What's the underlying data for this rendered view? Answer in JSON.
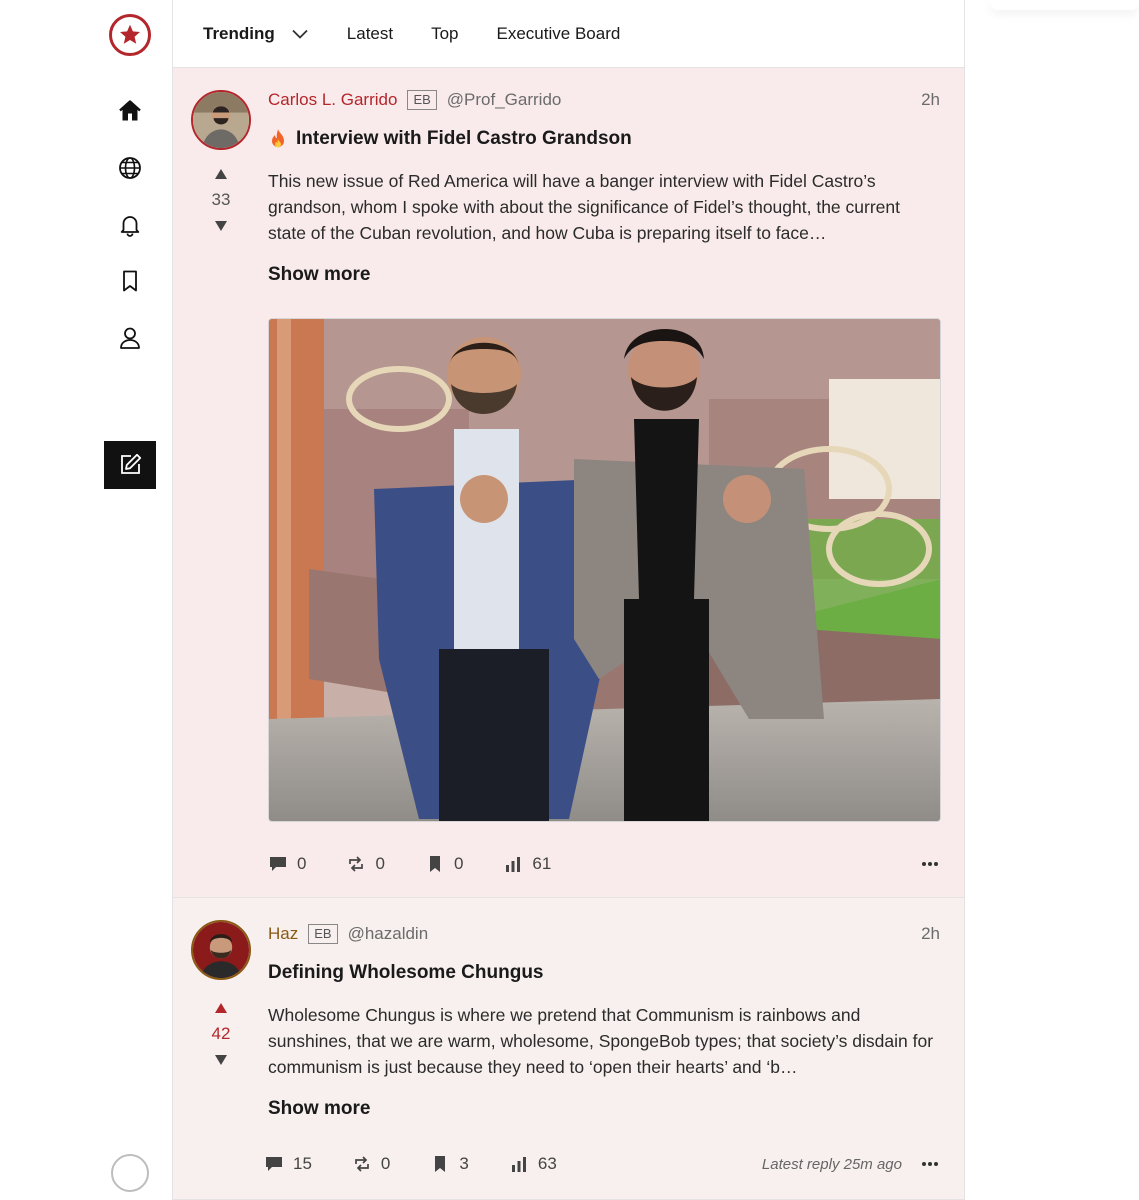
{
  "tabs": [
    {
      "label": "Trending",
      "active": true
    },
    {
      "label": "Latest"
    },
    {
      "label": "Top"
    },
    {
      "label": "Executive Board"
    }
  ],
  "sidebar": {
    "logo": "red-star-logo",
    "items": [
      "home-icon",
      "globe-icon",
      "bell-icon",
      "bookmark-icon",
      "user-icon"
    ],
    "compose": "compose-icon"
  },
  "colors": {
    "brand": "#b3262b",
    "post1_bg": "#f9ebeb",
    "post2_bg": "#f7f0ee",
    "gold": "#8a5a14"
  },
  "posts": [
    {
      "author": "Carlos L. Garrido",
      "badge": "EB",
      "handle": "@Prof_Garrido",
      "time": "2h",
      "votes": "33",
      "title": "Interview with Fidel Castro Grandson",
      "title_icon": "flame-icon",
      "body": "This new issue of Red America will have a banger interview with Fidel Castro’s grandson, whom I spoke with about the significance of Fidel’s thought, the current state of the Cuban revolution, and how Cuba is preparing itself to face…",
      "show_more": "Show more",
      "stats": {
        "comments": "0",
        "reposts": "0",
        "bookmarks": "0",
        "views": "61"
      }
    },
    {
      "author": "Haz",
      "badge": "EB",
      "handle": "@hazaldin",
      "time": "2h",
      "votes": "42",
      "title": "Defining Wholesome Chungus",
      "body": "Wholesome Chungus is where we pretend that Communism is rainbows and sunshines, that we are warm, wholesome, SpongeBob types; that society’s disdain for communism is just because they need to ‘open their hearts’ and ‘b…",
      "show_more": "Show more",
      "stats": {
        "comments": "15",
        "reposts": "0",
        "bookmarks": "3",
        "views": "63"
      },
      "latest_reply": "Latest reply 25m ago"
    }
  ]
}
